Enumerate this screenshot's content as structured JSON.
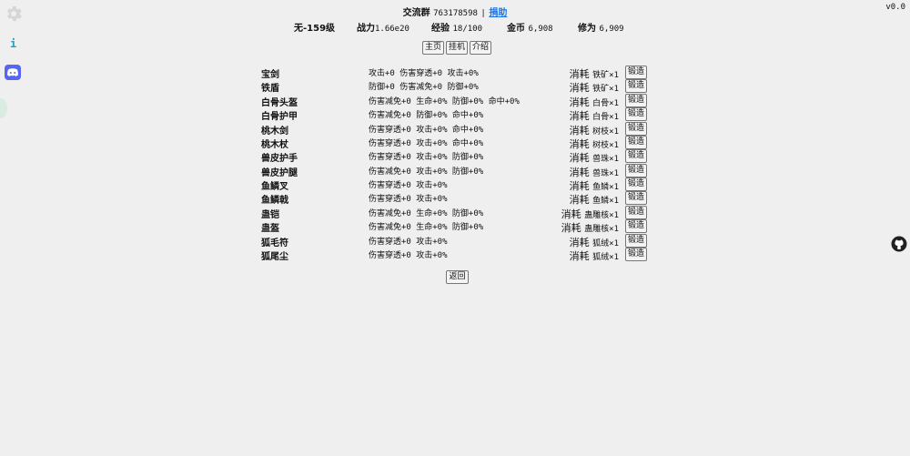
{
  "header": {
    "group_label": "交流群",
    "group_number": "763178598",
    "separator": "|",
    "donate_link": "捐助",
    "version": "v0.0"
  },
  "sidebar": {
    "settings_icon": "gear-icon",
    "info_text": "i",
    "discord_icon": "discord-icon",
    "github_icon": "github-icon"
  },
  "stats": {
    "realm": "无-159级",
    "power_label": "战力",
    "power_value": "1.66e20",
    "exp_label": "经验",
    "exp_value": "18/100",
    "gold_label": "金币",
    "gold_value": "6,908",
    "cultivation_label": "修为",
    "cultivation_value": "6,909"
  },
  "nav": {
    "home": "主页",
    "idle": "挂机",
    "intro": "介绍"
  },
  "forge_label": "锻造",
  "back_label": "返回",
  "items": [
    {
      "name": "宝剑",
      "effects": "攻击+0 伤害穿透+0 攻击+0%",
      "cost_label": "消耗",
      "cost": "铁矿×1"
    },
    {
      "name": "铁盾",
      "effects": "防御+0 伤害减免+0 防御+0%",
      "cost_label": "消耗",
      "cost": "铁矿×1"
    },
    {
      "name": "白骨头盔",
      "effects": "伤害减免+0 生命+0% 防御+0% 命中+0%",
      "cost_label": "消耗",
      "cost": "白骨×1"
    },
    {
      "name": "白骨护甲",
      "effects": "伤害减免+0 防御+0% 命中+0%",
      "cost_label": "消耗",
      "cost": "白骨×1"
    },
    {
      "name": "桃木剑",
      "effects": "伤害穿透+0 攻击+0% 命中+0%",
      "cost_label": "消耗",
      "cost": "树枝×1"
    },
    {
      "name": "桃木杖",
      "effects": "伤害穿透+0 攻击+0% 命中+0%",
      "cost_label": "消耗",
      "cost": "树枝×1"
    },
    {
      "name": "兽皮护手",
      "effects": "伤害穿透+0 攻击+0% 防御+0%",
      "cost_label": "消耗",
      "cost": "兽珠×1"
    },
    {
      "name": "兽皮护腿",
      "effects": "伤害减免+0 攻击+0% 防御+0%",
      "cost_label": "消耗",
      "cost": "兽珠×1"
    },
    {
      "name": "鱼鳞叉",
      "effects": "伤害穿透+0 攻击+0%",
      "cost_label": "消耗",
      "cost": "鱼鳞×1"
    },
    {
      "name": "鱼鳞戟",
      "effects": "伤害穿透+0 攻击+0%",
      "cost_label": "消耗",
      "cost": "鱼鳞×1"
    },
    {
      "name": "蛊铠",
      "effects": "伤害减免+0 生命+0% 防御+0%",
      "cost_label": "消耗",
      "cost": "蛊雕核×1"
    },
    {
      "name": "蛊盔",
      "effects": "伤害减免+0 生命+0% 防御+0%",
      "cost_label": "消耗",
      "cost": "蛊雕核×1"
    },
    {
      "name": "狐毛符",
      "effects": "伤害穿透+0 攻击+0%",
      "cost_label": "消耗",
      "cost": "狐绒×1"
    },
    {
      "name": "狐尾尘",
      "effects": "伤害穿透+0 攻击+0%",
      "cost_label": "消耗",
      "cost": "狐绒×1"
    }
  ]
}
